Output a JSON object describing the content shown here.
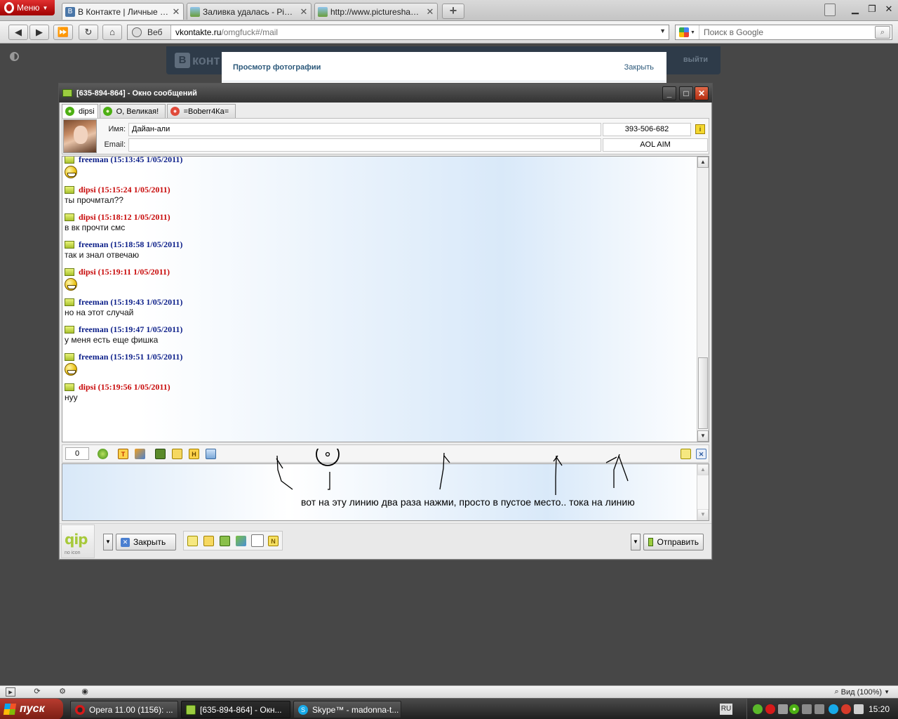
{
  "browser": {
    "menu_label": "Меню",
    "tabs": [
      {
        "label": "В Контакте | Личные со...",
        "icon": "vk-icon",
        "close": "✕"
      },
      {
        "label": "Заливка удалась - Pictu...",
        "icon": "image-icon",
        "close": "✕"
      },
      {
        "label": "http://www.pictureshack....",
        "icon": "image-icon",
        "close": "✕"
      }
    ],
    "new_tab": "+",
    "address": {
      "label": "Веб",
      "domain": "vkontakte.ru",
      "path": "/omgfuck#/mail"
    },
    "search_placeholder": "Поиск в Google",
    "zoom": "Вид (100%)"
  },
  "vk": {
    "logo_letter": "В",
    "logo_text": "конт",
    "exit": "выйти",
    "popup_title": "Просмотр фотографии",
    "popup_close": "Закрыть"
  },
  "qip": {
    "title": "[635-894-864] - Окно сообщений",
    "contact_tabs": [
      {
        "label": "dipsi",
        "icon": "green"
      },
      {
        "label": "О, Великая!",
        "icon": "green"
      },
      {
        "label": "=Boberr4Ка=",
        "icon": "red"
      }
    ],
    "contact": {
      "name_label": "Имя:",
      "name": "Дайан-али",
      "email_label": "Email:",
      "email": "",
      "uin": "393-506-682",
      "protocol": "AOL AIM"
    },
    "messages": [
      {
        "sender": "freeman",
        "who": "me",
        "header": "freeman (15:13:45 1/05/2011)",
        "text": "",
        "smile": true
      },
      {
        "sender": "dipsi",
        "who": "peer",
        "header": "dipsi (15:15:24 1/05/2011)",
        "text": "ты прочмтал??",
        "smile": false
      },
      {
        "sender": "dipsi",
        "who": "peer",
        "header": "dipsi (15:18:12 1/05/2011)",
        "text": "в вк прочти смс",
        "smile": false
      },
      {
        "sender": "freeman",
        "who": "me",
        "header": "freeman (15:18:58 1/05/2011)",
        "text": "так и знал отвечаю",
        "smile": false
      },
      {
        "sender": "dipsi",
        "who": "peer",
        "header": "dipsi (15:19:11 1/05/2011)",
        "text": "",
        "smile": true
      },
      {
        "sender": "freeman",
        "who": "me",
        "header": "freeman (15:19:43 1/05/2011)",
        "text": "но на этот  случай",
        "smile": false
      },
      {
        "sender": "freeman",
        "who": "me",
        "header": "freeman (15:19:47 1/05/2011)",
        "text": "у меня есть еще фишка",
        "smile": false
      },
      {
        "sender": "freeman",
        "who": "me",
        "header": "freeman (15:19:51 1/05/2011)",
        "text": "",
        "smile": true
      },
      {
        "sender": "dipsi",
        "who": "peer",
        "header": "dipsi (15:19:56 1/05/2011)",
        "text": "нуу",
        "smile": false
      }
    ],
    "char_counter": "0",
    "annotation": "вот на эту линию два раза нажми, просто в пустое место.. тока на линию",
    "close_button": "Закрыть",
    "send_button": "Отправить",
    "logo_text": "qip",
    "logo_sub": "no icon"
  },
  "taskbar": {
    "start": "пуск",
    "items": [
      {
        "label": "Opera 11.00 (1156): ..."
      },
      {
        "label": "[635-894-864] - Окн..."
      },
      {
        "label": "Skype™ - madonna-t..."
      }
    ],
    "lang": "RU",
    "clock": "15:20"
  },
  "colors": {
    "me": "#0a1d88",
    "peer": "#c80a0a"
  }
}
